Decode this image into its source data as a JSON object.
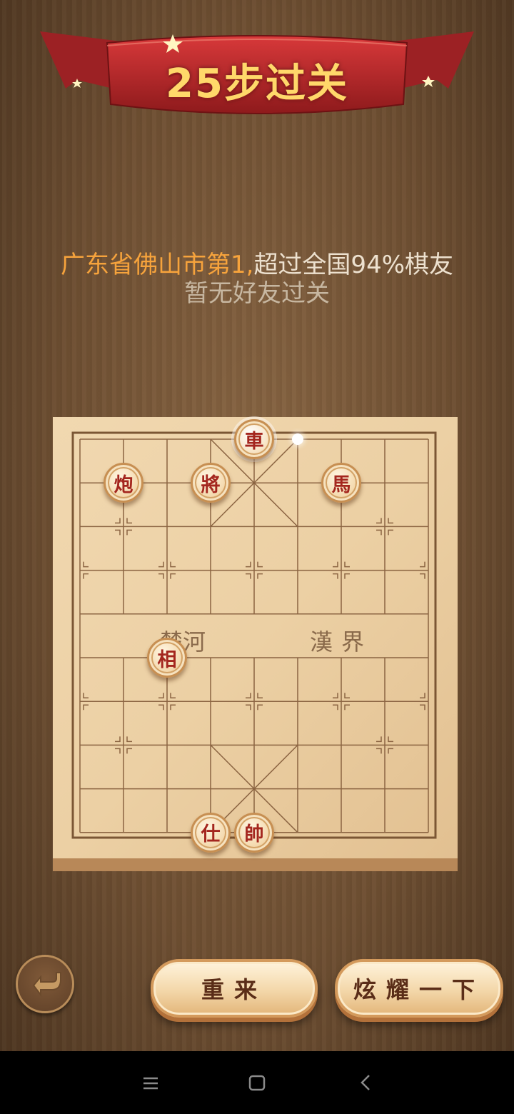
{
  "banner": {
    "title": "25步过关"
  },
  "result": {
    "rank_highlight": "广东省佛山市第1,",
    "rank_rest": "超过全国94%棋友",
    "friends": "暂无好友过关"
  },
  "board": {
    "river_left": "楚河",
    "river_right": "漢界",
    "pieces": [
      {
        "name": "chariot",
        "char": "車",
        "file": 4,
        "rank": 0,
        "highlighted": true
      },
      {
        "name": "cannon",
        "char": "炮",
        "file": 1,
        "rank": 1
      },
      {
        "name": "general",
        "char": "將",
        "file": 3,
        "rank": 1
      },
      {
        "name": "horse",
        "char": "馬",
        "file": 6,
        "rank": 1
      },
      {
        "name": "elephant",
        "char": "相",
        "file": 2,
        "rank": 5
      },
      {
        "name": "advisor",
        "char": "仕",
        "file": 3,
        "rank": 9
      },
      {
        "name": "marshal",
        "char": "帥",
        "file": 4,
        "rank": 9
      }
    ],
    "move_target": {
      "file": 5,
      "rank": 0
    }
  },
  "buttons": {
    "restart": "重来",
    "share": "炫耀一下"
  },
  "icons": {
    "back": "return-arrow-icon",
    "nav_menu": "menu-icon",
    "nav_home": "square-home-icon",
    "nav_back": "chevron-left-icon"
  },
  "colors": {
    "piece_text": "#a4261e",
    "rank_highlight": "#f6a33c",
    "banner": "#b5262a"
  }
}
